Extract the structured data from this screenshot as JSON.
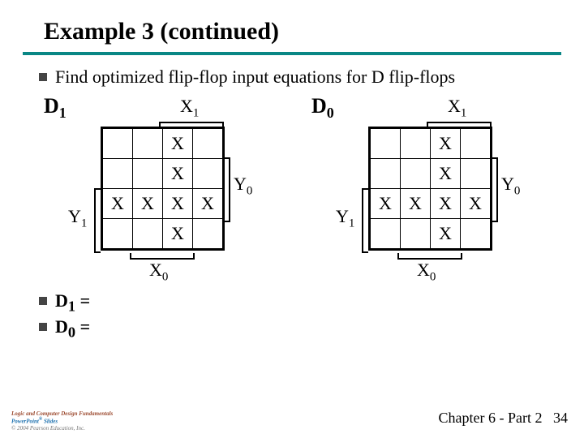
{
  "title": "Example 3 (continued)",
  "bullet": "Find optimized flip-flop input equations for D flip-flops",
  "maps": [
    {
      "name_html": "D<sub>1</sub>",
      "top_axis_html": "X<sub>1</sub>",
      "right_axis_html": "Y<sub>0</sub>",
      "left_axis_html": "Y<sub>1</sub>",
      "bottom_axis_html": "X<sub>0</sub>",
      "cells": [
        [
          "",
          "",
          "X",
          ""
        ],
        [
          "",
          "",
          "X",
          ""
        ],
        [
          "X",
          "X",
          "X",
          "X"
        ],
        [
          "",
          "",
          "X",
          ""
        ]
      ]
    },
    {
      "name_html": "D<sub>0</sub>",
      "top_axis_html": "X<sub>1</sub>",
      "right_axis_html": "Y<sub>0</sub>",
      "left_axis_html": "Y<sub>1</sub>",
      "bottom_axis_html": "X<sub>0</sub>",
      "cells": [
        [
          "",
          "",
          "X",
          ""
        ],
        [
          "",
          "",
          "X",
          ""
        ],
        [
          "X",
          "X",
          "X",
          "X"
        ],
        [
          "",
          "",
          "X",
          ""
        ]
      ]
    }
  ],
  "equations": [
    "D<sub>1</sub> =",
    "D<sub>0</sub> ="
  ],
  "footer": {
    "logic": "Logic and Computer Design Fundamentals",
    "powerpoint": "PowerPoint<sup>®</sup> Slides",
    "copyright": "© 2004 Pearson Education, Inc.",
    "chapter": "Chapter 6 - Part 2",
    "page": "34"
  },
  "chart_data": {
    "type": "table",
    "description": "Two 4×4 Karnaugh maps (K-maps) for D flip-flop input equations D1 and D0. Columns indexed by X1, rows by Y1; Y0 on right bracket, X0 on bottom bracket. X marks minterms.",
    "kmaps": [
      {
        "output": "D1",
        "column_var_top": "X1",
        "row_var_left": "Y1",
        "bracket_right": "Y0",
        "bracket_bottom": "X0",
        "grid_rows": [
          [
            "",
            "",
            "X",
            ""
          ],
          [
            "",
            "",
            "X",
            ""
          ],
          [
            "X",
            "X",
            "X",
            "X"
          ],
          [
            "",
            "",
            "X",
            ""
          ]
        ]
      },
      {
        "output": "D0",
        "column_var_top": "X1",
        "row_var_left": "Y1",
        "bracket_right": "Y0",
        "bracket_bottom": "X0",
        "grid_rows": [
          [
            "",
            "",
            "X",
            ""
          ],
          [
            "",
            "",
            "X",
            ""
          ],
          [
            "X",
            "X",
            "X",
            "X"
          ],
          [
            "",
            "",
            "X",
            ""
          ]
        ]
      }
    ]
  }
}
